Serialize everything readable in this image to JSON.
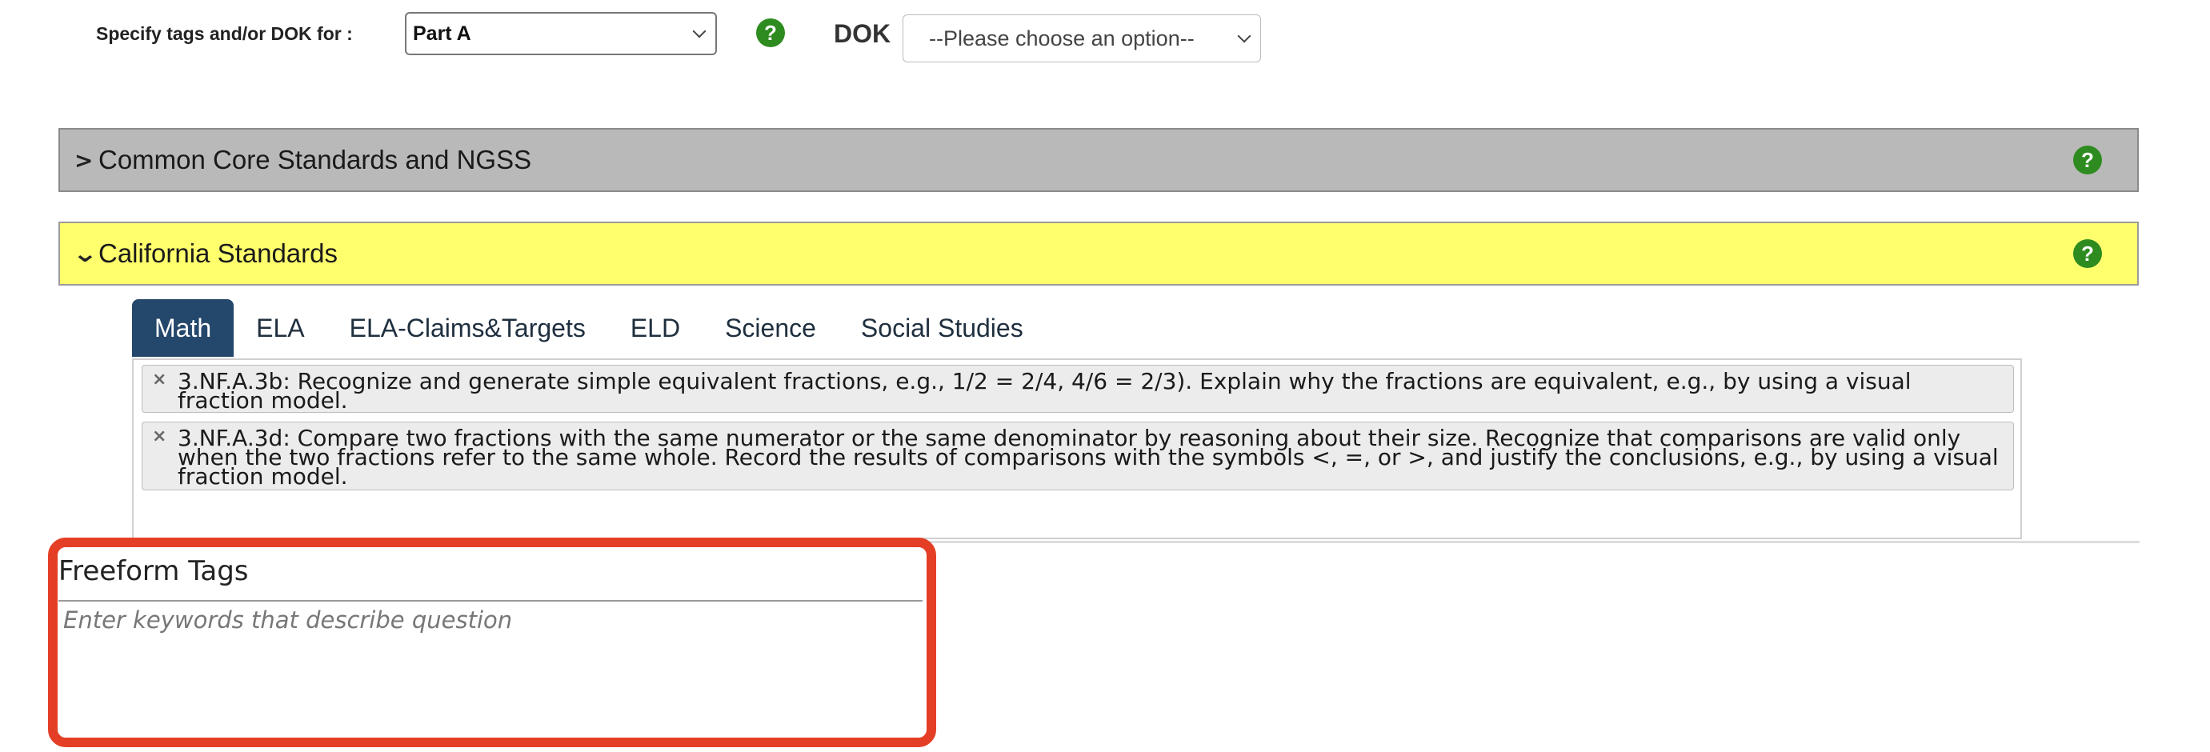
{
  "header": {
    "spec_label": "Specify tags and/or DOK for :",
    "part_select_value": "Part A",
    "dok_label": "DOK",
    "dok_select_value": "--Please choose an option--",
    "help_glyph": "?"
  },
  "accordions": [
    {
      "title": "Common Core Standards and NGSS",
      "expanded": false,
      "arrow": "›"
    },
    {
      "title": "California Standards",
      "expanded": true,
      "arrow": "⌄"
    }
  ],
  "tabs": [
    {
      "label": "Math",
      "active": true
    },
    {
      "label": "ELA",
      "active": false
    },
    {
      "label": "ELA-Claims&Targets",
      "active": false
    },
    {
      "label": "ELD",
      "active": false
    },
    {
      "label": "Science",
      "active": false
    },
    {
      "label": "Social Studies",
      "active": false
    }
  ],
  "selected_tags": [
    {
      "text": "3.NF.A.3b: Recognize and generate simple equivalent fractions, e.g., 1/2 = 2/4, 4/6 = 2/3). Explain why the fractions are equivalent, e.g., by using a visual fraction model.",
      "remove": "×"
    },
    {
      "text": "3.NF.A.3d: Compare two fractions with the same numerator or the same denominator by reasoning about their size. Recognize that comparisons are valid only when the two fractions refer to the same whole. Record the results of comparisons with the symbols <, =, or >, and justify the conclusions, e.g., by using a visual fraction model.",
      "remove": "×"
    }
  ],
  "freeform": {
    "label": "Freeform Tags",
    "placeholder": "Enter keywords that describe question",
    "value": ""
  },
  "colors": {
    "help_green": "#2e8b1f",
    "active_tab": "#24476c",
    "california_bg": "#ffff6e",
    "common_core_bg": "#b9b9b9",
    "highlight": "#e43f26"
  }
}
